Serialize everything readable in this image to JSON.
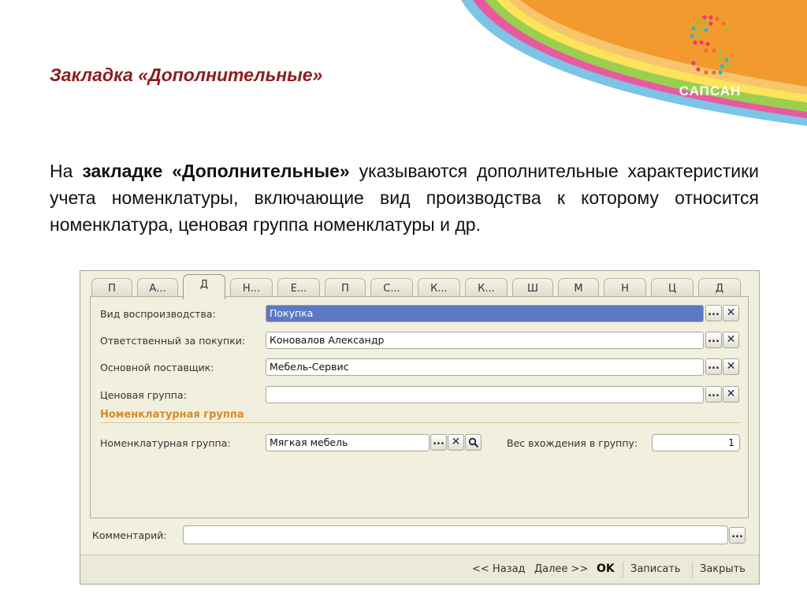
{
  "slide": {
    "title": "Закладка «Дополнительные»",
    "para_prefix": "На ",
    "para_bold": "закладке «Дополнительные»",
    "para_rest": " указываются дополнительные характеристики учета номенклатуры, включающие вид производства к которому относится номенклатура, ценовая группа номенклатуры и др.",
    "logo_text": "САПСАН"
  },
  "form": {
    "tabs": [
      "П",
      "А...",
      "Д",
      "Н...",
      "Е...",
      "П",
      "С...",
      "К...",
      "К...",
      "Ш",
      "М",
      "Н",
      "Ц",
      "Д"
    ],
    "active_tab_index": 2,
    "fields": {
      "reproduction_type": {
        "label": "Вид воспроизводства:",
        "value": "Покупка"
      },
      "purchase_responsible": {
        "label": "Ответственный за покупки:",
        "value": "Коновалов Александр"
      },
      "main_supplier": {
        "label": "Основной поставщик:",
        "value": "Мебель-Сервис"
      },
      "price_group": {
        "label": "Ценовая группа:",
        "value": ""
      }
    },
    "group_title": "Номенклатурная группа",
    "nomenclature_group": {
      "label": "Номенклатурная группа:",
      "value": "Мягкая мебель"
    },
    "group_weight": {
      "label": "Вес вхождения в группу:",
      "value": "1"
    },
    "comment": {
      "label": "Комментарий:",
      "value": ""
    },
    "buttons": {
      "ellipsis": "...",
      "clear": "✕",
      "back": "<< Назад",
      "next": "Далее >>",
      "ok": "OK",
      "save": "Записать",
      "close": "Закрыть"
    }
  },
  "colors": {
    "accent_orange": "#f39a2e",
    "title_red": "#8c1d1d",
    "selection_blue": "#5a78c6",
    "group_orange": "#d88a2a"
  },
  "icons": {
    "search": "magnifier-icon",
    "logo": "dot-matrix-s-logo"
  }
}
